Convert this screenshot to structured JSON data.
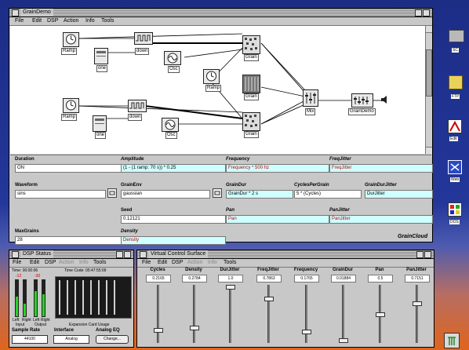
{
  "desktop": {
    "icons": [
      {
        "label": "SC",
        "icon": "drive-icon"
      },
      {
        "label": "FTP",
        "icon": "folder-icon"
      },
      {
        "label": "Edit",
        "icon": "edit-icon"
      },
      {
        "label": "Web",
        "icon": "web-icon"
      },
      {
        "label": "DOS",
        "icon": "dos-icon"
      }
    ]
  },
  "grain": {
    "title": "GrainDemo",
    "menu": [
      "File",
      "Edit",
      "DSP",
      "Action",
      "Info",
      "Tools"
    ],
    "nodes": {
      "ramp1": "Ramp",
      "one": "one",
      "down1": "down",
      "osc1": "Osc",
      "grain1": "Grain",
      "ramp_mid": "Ramp",
      "grain_mid": "Grain",
      "ramp2": "Ramp",
      "one2": "one",
      "down2": "down",
      "osc2": "Osc",
      "grain2": "Grain",
      "mix": "Mix",
      "graindemo": "GrainDemo"
    },
    "fields": {
      "duration": {
        "label": "Duration",
        "value": "ON"
      },
      "amplitude": {
        "label": "Amplitude",
        "value": "(1 - (1 ramp: 70 s)) * 0.25"
      },
      "frequency": {
        "label": "Frequency",
        "value": "Frequency * 500 hz"
      },
      "freqjitter": {
        "label": "FreqJitter",
        "value": "FreqJitter"
      },
      "waveform": {
        "label": "Waveform",
        "value": "sins"
      },
      "grainenv": {
        "label": "GrainEnv",
        "value": "gaussian"
      },
      "graindur": {
        "label": "GrainDur",
        "value": "GrainDur * 2 s"
      },
      "cyclespergrain": {
        "label": "CyclesPerGrain",
        "value": "5 * (Cycles)"
      },
      "graindurjitter": {
        "label": "GrainDurJitter",
        "value": "DurJitter"
      },
      "seed": {
        "label": "Seed",
        "value": "0.12121"
      },
      "pan": {
        "label": "Pan",
        "value": "Pan"
      },
      "panjitter": {
        "label": "PanJitter",
        "value": "PanJitter"
      },
      "maxgrains": {
        "label": "MaxGrains",
        "value": "28"
      },
      "density": {
        "label": "Density",
        "value": "Density"
      }
    },
    "footer": "GrainCloud"
  },
  "dsp": {
    "title": "DSP Status",
    "menu": [
      "File",
      "Edit",
      "DSP",
      "Action",
      "Info",
      "Tools"
    ],
    "time_label": "Time: 00:00:06",
    "timecode_label": "Time Code: 05:47:55:09",
    "input_peak": "-12",
    "output_peak": "-30",
    "meter_labels": [
      "Left",
      "Right",
      "Left",
      "Right"
    ],
    "meter_levels": [
      0.55,
      0.35,
      0.7,
      0.6
    ],
    "section_labels": [
      "Input",
      "Output",
      "Expansion Card Usage"
    ],
    "sample_rate_label": "Sample Rate",
    "sample_rate_value": "44100",
    "interface_label": "Interface",
    "interface_value": "Analog",
    "analog_eq_label": "Analog EQ",
    "analog_eq_value": "Change..."
  },
  "vcs": {
    "title": "Virtual Control Surface",
    "menu": [
      "File",
      "Edit",
      "DSP",
      "Action",
      "Info",
      "Tools"
    ],
    "sliders": [
      {
        "label": "Cycles",
        "value": "0.2165",
        "level": 0.2
      },
      {
        "label": "Density",
        "value": "0.2784",
        "level": 0.25
      },
      {
        "label": "DurJitter",
        "value": "1.0",
        "level": 1.0
      },
      {
        "label": "FreqJitter",
        "value": "0.7863",
        "level": 0.78
      },
      {
        "label": "Frequency",
        "value": "0.1765",
        "level": 0.18
      },
      {
        "label": "GrainDur",
        "value": "0.01884",
        "level": 0.02
      },
      {
        "label": "Pan",
        "value": "0.5",
        "level": 0.5
      },
      {
        "label": "PanJitter",
        "value": "0.7151",
        "level": 0.7
      }
    ]
  }
}
